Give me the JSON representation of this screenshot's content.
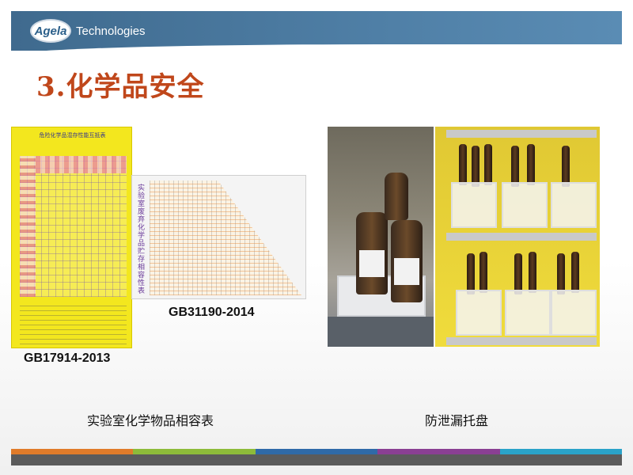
{
  "header": {
    "logo_text": "Agela",
    "company": "Technologies"
  },
  "title": "3.化学品安全",
  "left_images": {
    "yellow_chart": {
      "heading": "危险化学品混存性能互抵表"
    },
    "triangle_chart": {
      "vertical_title": "实验室废弃化学品贮存相容性表"
    },
    "label_gb31190": "GB31190-2014",
    "label_gb17914": "GB17914-2013",
    "caption": "实验室化学物品相容表"
  },
  "right_images": {
    "caption": "防泄漏托盘"
  },
  "colors": {
    "title": "#c0471b",
    "header_band": "#4f7fa6",
    "footer_segments": [
      "#e07b2a",
      "#8dbb3a",
      "#2f6aa8",
      "#8a3f93",
      "#2aa3c9"
    ]
  }
}
